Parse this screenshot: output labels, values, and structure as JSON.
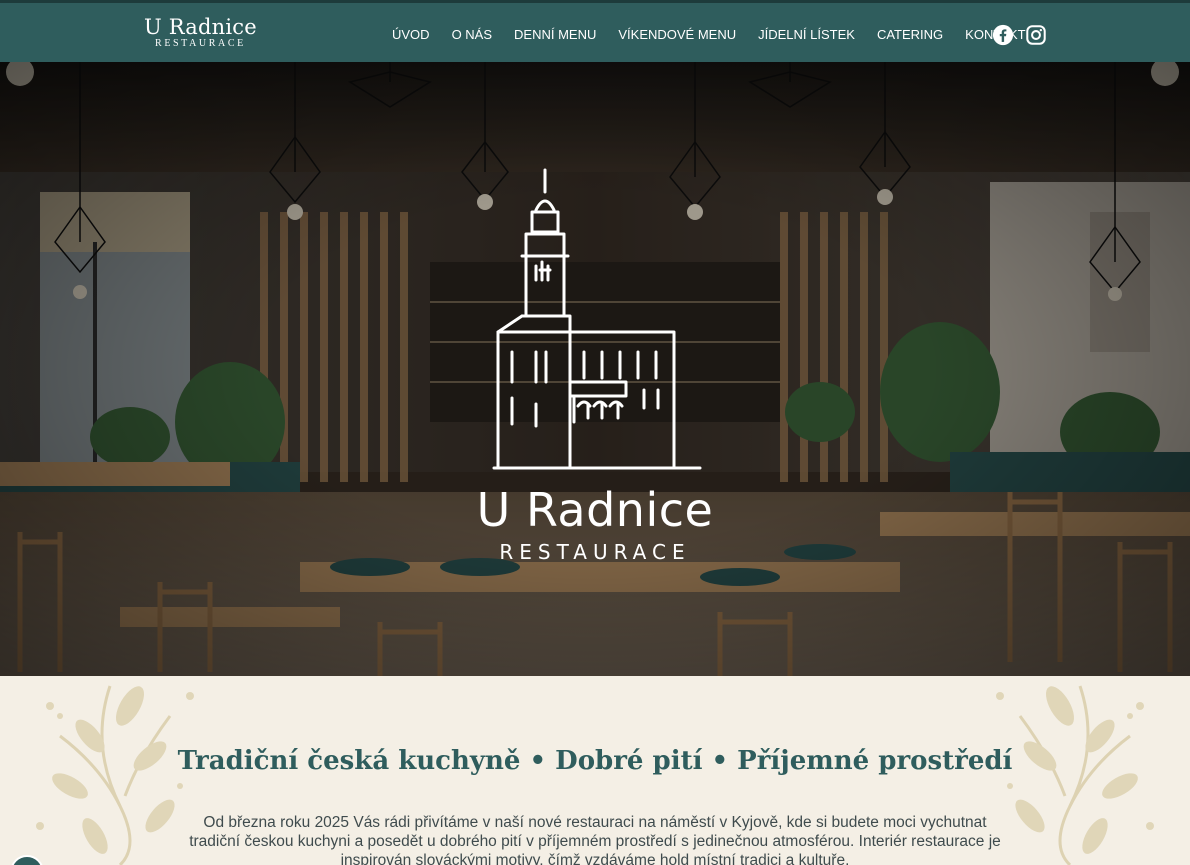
{
  "brand": {
    "name": "U Radnice",
    "sub": "RESTAURACE"
  },
  "nav": {
    "items": [
      {
        "label": "ÚVOD"
      },
      {
        "label": "O NÁS"
      },
      {
        "label": "DENNÍ MENU"
      },
      {
        "label": "VÍKENDOVÉ MENU"
      },
      {
        "label": "JÍDELNÍ LÍSTEK"
      },
      {
        "label": "CATERING"
      },
      {
        "label": "KONTAKT"
      }
    ]
  },
  "social": {
    "icons": [
      "facebook-icon",
      "instagram-icon"
    ]
  },
  "hero": {
    "title": "U Radnice",
    "subtitle": "RESTAURACE"
  },
  "intro": {
    "tagline": "Tradiční česká kuchyně • Dobré pití • Příjemné prostředí",
    "text": "Od března roku 2025 Vás rádi přivítáme v naší nové restauraci na náměstí v Kyjově, kde si budete moci vychutnat tradiční českou kuchyni a posedět u dobrého pití v příjemném prostředí s jedinečnou atmosférou. Interiér restaurace je inspirován slováckými motivy, čímž vzdáváme hold místní tradici a kultuře."
  },
  "colors": {
    "primary": "#2f5d5d",
    "background": "#f4efe5",
    "text": "#3f4b4d"
  }
}
